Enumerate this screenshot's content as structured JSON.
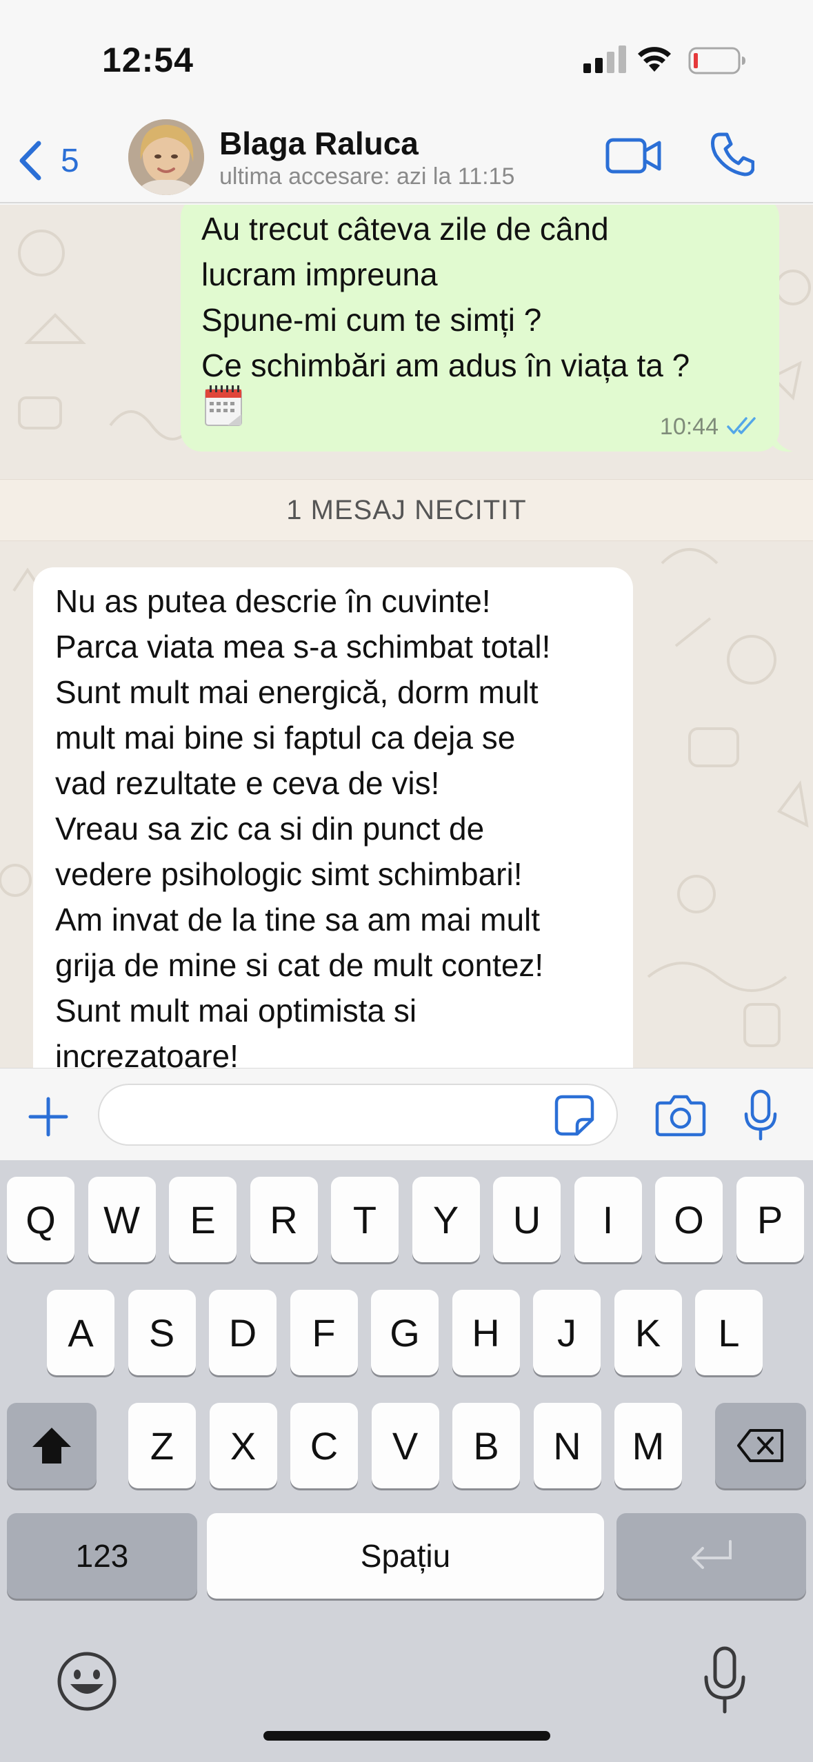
{
  "status_bar": {
    "time": "12:54",
    "icons": [
      "cellular-signal-icon",
      "wifi-icon",
      "battery-low-icon"
    ]
  },
  "header": {
    "back_count": "5",
    "contact_name": "Blaga Raluca",
    "last_seen": "ultima accesare: azi la 11:15",
    "icons": [
      "chevron-left-icon",
      "video-call-icon",
      "phone-icon"
    ]
  },
  "messages": [
    {
      "direction": "outgoing",
      "text": "Au trecut câteva zile de când\nlucram impreuna\nSpune-mi cum te simți ?\nCe schimbări am adus în viața ta ?",
      "emoji": "calendar-icon",
      "time": "10:44",
      "status": "read"
    },
    {
      "direction": "incoming",
      "text": "Nu as putea descrie în cuvinte!\nParca viata mea s-a schimbat total!\nSunt mult mai energică, dorm mult\nmult mai bine si faptul ca deja se\nvad rezultate e ceva de vis!\nVreau sa zic ca si din punct de\nvedere psihologic simt schimbari!\nAm invat de la tine sa am mai mult\ngrija de mine si cat de mult contez!\nSunt mult mai optimista si\nincrezatoare!"
    }
  ],
  "unread_banner": "1 MESAJ NECITIT",
  "input_bar": {
    "placeholder": "",
    "icons": [
      "plus-icon",
      "sticker-icon",
      "camera-icon",
      "microphone-icon"
    ]
  },
  "keyboard": {
    "row1": [
      "Q",
      "W",
      "E",
      "R",
      "T",
      "Y",
      "U",
      "I",
      "O",
      "P"
    ],
    "row2": [
      "A",
      "S",
      "D",
      "F",
      "G",
      "H",
      "J",
      "K",
      "L"
    ],
    "row3": [
      "Z",
      "X",
      "C",
      "V",
      "B",
      "N",
      "M"
    ],
    "numbers_label": "123",
    "space_label": "Spațiu",
    "icons": [
      "shift-icon",
      "backspace-icon",
      "return-icon",
      "emoji-icon",
      "dictation-mic-icon"
    ]
  },
  "colors": {
    "accent": "#2b6fd6",
    "outgoing_bubble": "#e1fad0",
    "incoming_bubble": "#ffffff",
    "chat_background": "#ede8e1",
    "keyboard_background": "#d1d3d9"
  }
}
